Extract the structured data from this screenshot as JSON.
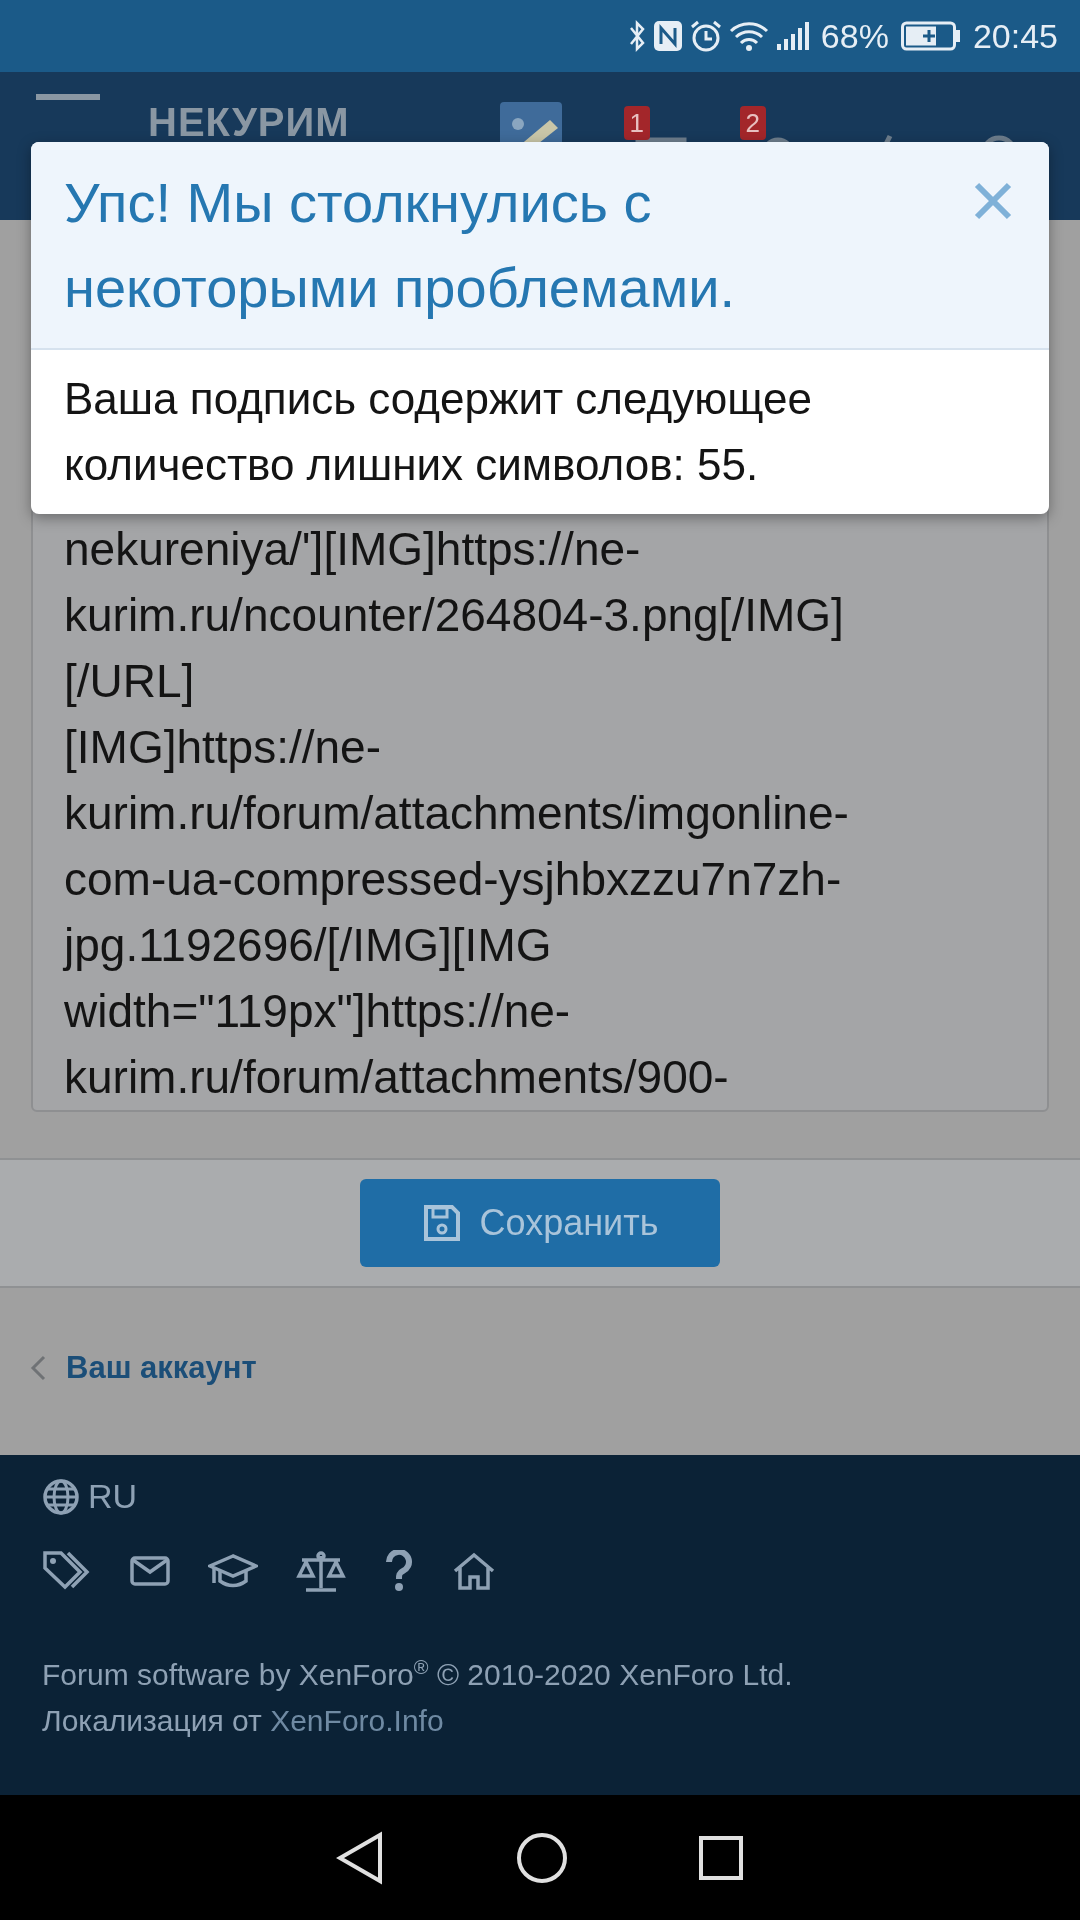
{
  "status_bar": {
    "battery": "68%",
    "time": "20:45"
  },
  "header": {
    "logo": "НЕКУРИМ",
    "badges": [
      {
        "count": "1"
      },
      {
        "count": "2"
      }
    ]
  },
  "modal": {
    "title": "Упс! Мы столкнулись с некоторыми проблемами.",
    "message": "Ваша подпись содержит следующее количество лишних символов: 55."
  },
  "signature_field": {
    "value": "nekureniya/'][IMG]https://ne-\nkurim.ru/ncounter/264804-3.png[/IMG]\n[/URL]\n[IMG]https://ne-\nkurim.ru/forum/attachments/imgonline-\ncom-ua-compressed-ysjhbxzzu7n7zh-\njpg.1192696/[/IMG][IMG\nwidth=\"119px\"]https://ne-\nkurim.ru/forum/attachments/900-"
  },
  "save_button": {
    "label": "Сохранить"
  },
  "breadcrumb": {
    "label": "Ваш аккаунт"
  },
  "footer": {
    "language": "RU",
    "copyright": "Forum software by XenForo$^{®}$ © 2010-2020 XenForo Ltd.",
    "localization_text": "Локализация от",
    "localization_link": "XenForo.Info"
  }
}
